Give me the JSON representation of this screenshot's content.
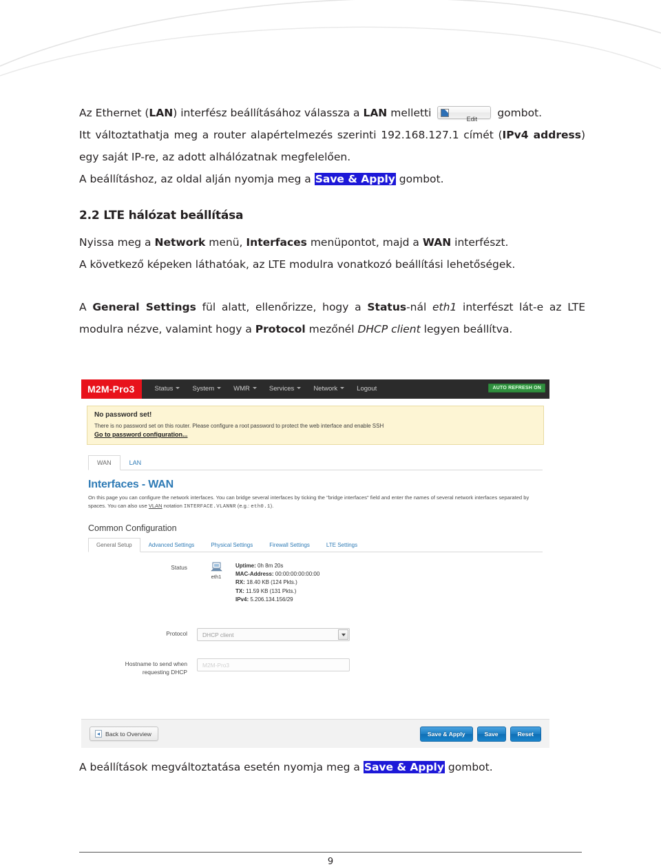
{
  "document": {
    "paragraph1": {
      "part1": "Az Ethernet (",
      "bold1": "LAN",
      "part2": ") interfész beállításához válassza a ",
      "bold2": "LAN",
      "part3": " melletti ",
      "edit_button_label": "Edit",
      "part4": " gombot."
    },
    "paragraph2": {
      "part1": "Itt változtathatja meg a router alapértelmezés szerinti 192.168.127.1 címét (",
      "bold1": "IPv4 address",
      "part2": ") egy saját IP-re, az adott alhálózatnak megfelelően."
    },
    "paragraph3": {
      "part1": "A beállításhoz, az oldal alján nyomja meg a ",
      "highlight": "Save & Apply",
      "part2": " gombot."
    },
    "heading": "2.2 LTE hálózat beállítása",
    "paragraph4": {
      "part1": "Nyissa meg a ",
      "bold1": "Network",
      "part2": " menü, ",
      "bold2": "Interfaces",
      "part3": " menüpontot, majd a ",
      "bold3": "WAN",
      "part4": " interfészt."
    },
    "paragraph5": "A következő képeken láthatóak, az LTE modulra vonatkozó beállítási lehetőségek.",
    "paragraph6": {
      "part1": "A ",
      "bold1": "General Settings",
      "part2": " fül alatt, ellenőrizze, hogy a ",
      "bold2": "Status",
      "part3": "-nál ",
      "italic1": "eth1",
      "part4": " interfészt lát-e az LTE modulra nézve, valamint hogy a ",
      "bold3": "Protocol",
      "part5": " mezőnél ",
      "italic2": "DHCP client",
      "part6": " legyen beállítva."
    },
    "paragraph7": {
      "part1": "A beállítások megváltoztatása esetén nyomja meg a ",
      "highlight": "Save & Apply",
      "part2": " gombot."
    },
    "page_number": "9"
  },
  "screenshot": {
    "navbar": {
      "brand": "M2M-Pro3",
      "items": [
        {
          "label": "Status",
          "has_caret": true
        },
        {
          "label": "System",
          "has_caret": true
        },
        {
          "label": "WMR",
          "has_caret": true
        },
        {
          "label": "Services",
          "has_caret": true
        },
        {
          "label": "Network",
          "has_caret": true
        },
        {
          "label": "Logout",
          "has_caret": false
        }
      ],
      "refresh_badge": "AUTO REFRESH ON"
    },
    "warning": {
      "title": "No password set!",
      "text": "There is no password set on this router. Please configure a root password to protect the web interface and enable SSH",
      "link": "Go to password configuration..."
    },
    "tabs": [
      {
        "label": "WAN",
        "active": true
      },
      {
        "label": "LAN",
        "active": false
      }
    ],
    "page_title": "Interfaces - WAN",
    "page_desc_1": "On this page you can configure the network interfaces. You can bridge several interfaces by ticking the \"bridge interfaces\" field and enter the names of several",
    "page_desc_2_a": "network interfaces separated by spaces. You can also use ",
    "page_desc_2_vlan": "VLAN",
    "page_desc_2_b": " notation ",
    "page_desc_2_mono": "INTERFACE.VLANNR",
    "page_desc_2_c": " (e.g.: ",
    "page_desc_2_mono2": "eth0.1",
    "page_desc_2_d": ").",
    "section_title": "Common Configuration",
    "subtabs": [
      {
        "label": "General Setup",
        "active": true
      },
      {
        "label": "Advanced Settings",
        "active": false
      },
      {
        "label": "Physical Settings",
        "active": false
      },
      {
        "label": "Firewall Settings",
        "active": false
      },
      {
        "label": "LTE Settings",
        "active": false
      }
    ],
    "form": {
      "status_label": "Status",
      "interface_name": "eth1",
      "status_lines": [
        {
          "key": "Uptime:",
          "value": " 0h 8m 20s"
        },
        {
          "key": "MAC-Address:",
          "value": " 00:00:00:00:00:00"
        },
        {
          "key": "RX:",
          "value": " 18.40 KB (124 Pkts.)"
        },
        {
          "key": "TX:",
          "value": " 11.59 KB (131 Pkts.)"
        },
        {
          "key": "IPv4:",
          "value": " 5.206.134.156/29"
        }
      ],
      "protocol_label": "Protocol",
      "protocol_value": "DHCP client",
      "hostname_label_line1": "Hostname to send when",
      "hostname_label_line2": "requesting DHCP",
      "hostname_placeholder": "M2M-Pro3"
    },
    "footer_buttons": {
      "back": "Back to Overview",
      "save_apply": "Save & Apply",
      "save": "Save",
      "reset": "Reset"
    }
  },
  "colors": {
    "brand_red": "#e8121b",
    "navbar_dark": "#2b2b2b",
    "link_blue": "#2d7ab5",
    "button_blue": "#1d7fc4",
    "badge_green": "#2f8f3e",
    "warning_bg": "#fdf5d4",
    "highlight_blue": "#1d18d8"
  }
}
